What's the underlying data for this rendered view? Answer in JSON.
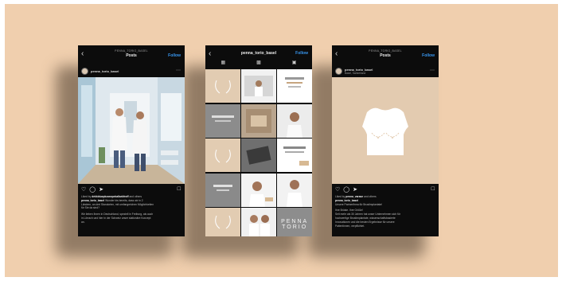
{
  "colors": {
    "background": "#f0cfae",
    "accent": "#3897f0",
    "beige": "#e3cbb0"
  },
  "phone1": {
    "header_small": "PENNA_TORIO_BASEL",
    "header_title": "Posts",
    "follow": "Follow",
    "username": "penna_torio_basel",
    "liked_by": "Liked by",
    "liked_user": "dekkbluepluswepekallarkfroff",
    "liked_rest": "and others",
    "caption_user": "penna_torio_basel",
    "caption_line1": "Wunder bis bereits, dass wir in 2",
    "caption_line2": "Ländern, an drei Standorten, mit umfangreichen Möglichkeiten",
    "caption_line3": "für Sie da sind?",
    "caption_line4": "Wir lieben Ihnen in Deutschland, speziell in Freiburg, als auch",
    "caption_line5": "in Lörrach und hier in der Schweiz unser stationäre Konzept",
    "caption_line6": "an."
  },
  "phone2": {
    "header_title": "penna_torio_basel",
    "follow": "Follow",
    "icons": [
      "grid-icon",
      "reels-icon",
      "tagged-icon"
    ],
    "grid_text": [
      "Penna",
      "Torio"
    ]
  },
  "phone3": {
    "header_small": "PENNA_TORIO_BASEL",
    "header_title": "Posts",
    "follow": "Follow",
    "username": "penna_torio_basel",
    "location": "Basel, Switzerland",
    "liked_by": "Liked by",
    "liked_user": "penna_varase",
    "liked_rest": "and others",
    "caption_user": "penna_torio_basel",
    "caption_line1": "Unsere Partnerfirma für Brustimplantate!",
    "caption_line2": "Ihre Brüste. Ihre Größe!",
    "caption_line3": "Seit mehr als 30 Jahren hat unser Unternehmen sich für",
    "caption_line4": "hochwertige Brustimplantate, wissenschaftsbasierte",
    "caption_line5": "Innovationen und die besten Ergebnisse für unsere",
    "caption_line6": "Patientinnen, verpflichtet."
  }
}
